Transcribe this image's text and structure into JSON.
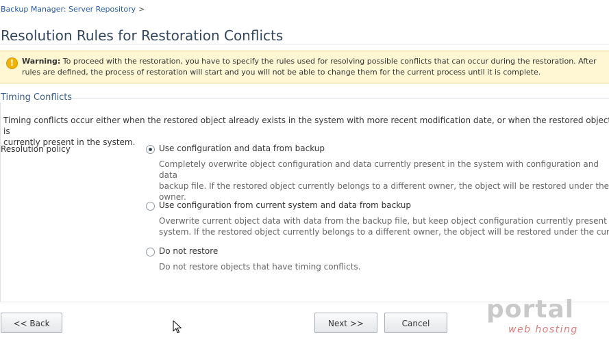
{
  "breadcrumb": {
    "link": "Backup Manager: Server Repository",
    "separator": ">"
  },
  "page_title": "Resolution Rules for Restoration Conflicts",
  "warning": {
    "icon": "warning-icon",
    "color": "#fff6d3",
    "label": "Warning:",
    "line1": "To proceed with the restoration, you have to specify the rules used for resolving possible conflicts that can occur during the restoration. After",
    "line2": "rules are defined, the process of restoration will start and you will not be able to change them for the current process until it is complete."
  },
  "section": {
    "title": "Timing Conflicts",
    "description_line1": "Timing conflicts occur either when the restored object already exists in the system with more recent modification date, or when the restored object is",
    "description_line2": "currently present in the system."
  },
  "resolution_policy": {
    "label": "Resolution policy",
    "selected_index": 0,
    "options": [
      {
        "label": "Use configuration and data from backup",
        "desc_lines": [
          "Completely overwrite object configuration and data currently present in the system with configuration and data",
          "backup file. If the restored object currently belongs to a different owner, the object will be restored under the f",
          "owner."
        ]
      },
      {
        "label": "Use configuration from current system and data from backup",
        "desc_lines": [
          "Overwrite current object data with data from the backup file, but keep object configuration currently present in",
          "system. If the restored object currently belongs to a different owner, the object will be restored under the curre"
        ]
      },
      {
        "label": "Do not restore",
        "desc_lines": [
          "Do not restore objects that have timing conflicts."
        ]
      }
    ]
  },
  "buttons": {
    "back": "<< Back",
    "next": "Next >>",
    "cancel": "Cancel"
  },
  "watermark": {
    "main": "portal",
    "sub": "web hosting"
  },
  "colors": {
    "title": "#33475e",
    "section_title": "#3a5f86",
    "link": "#2459a3",
    "warning_icon": "#f0b400"
  }
}
